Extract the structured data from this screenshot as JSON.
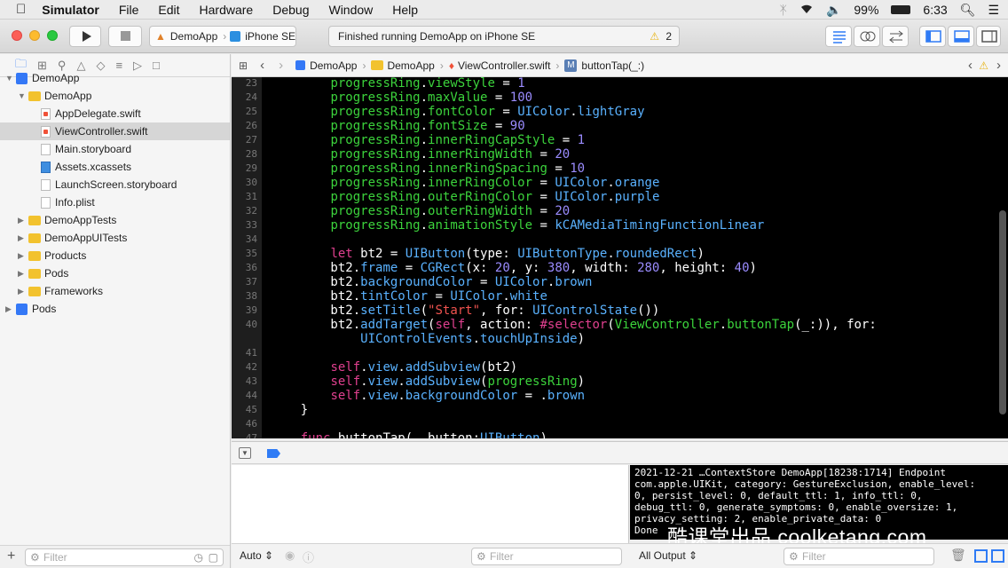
{
  "menubar": {
    "apple": "",
    "app": "Simulator",
    "items": [
      "File",
      "Edit",
      "Hardware",
      "Debug",
      "Window",
      "Help"
    ],
    "battery": "99%",
    "time": "6:33"
  },
  "toolbar": {
    "scheme": "DemoApp",
    "device": "iPhone SE",
    "activity": "Finished running DemoApp on iPhone SE",
    "warnings": "2"
  },
  "navigator": {
    "items": [
      {
        "label": "DemoApp",
        "kind": "project",
        "depth": 0,
        "open": true
      },
      {
        "label": "DemoApp",
        "kind": "folder",
        "depth": 1,
        "open": true
      },
      {
        "label": "AppDelegate.swift",
        "kind": "swift",
        "depth": 2
      },
      {
        "label": "ViewController.swift",
        "kind": "swift",
        "depth": 2,
        "selected": true
      },
      {
        "label": "Main.storyboard",
        "kind": "file",
        "depth": 2
      },
      {
        "label": "Assets.xcassets",
        "kind": "assets",
        "depth": 2
      },
      {
        "label": "LaunchScreen.storyboard",
        "kind": "file",
        "depth": 2
      },
      {
        "label": "Info.plist",
        "kind": "file",
        "depth": 2
      },
      {
        "label": "DemoAppTests",
        "kind": "folder",
        "depth": 1
      },
      {
        "label": "DemoAppUITests",
        "kind": "folder",
        "depth": 1
      },
      {
        "label": "Products",
        "kind": "folder",
        "depth": 1
      },
      {
        "label": "Pods",
        "kind": "folder",
        "depth": 1
      },
      {
        "label": "Frameworks",
        "kind": "folder",
        "depth": 1
      },
      {
        "label": "Pods",
        "kind": "project",
        "depth": 0
      }
    ],
    "filter_placeholder": "Filter"
  },
  "jumpbar": {
    "crumbs": [
      "DemoApp",
      "DemoApp",
      "ViewController.swift",
      "buttonTap(_:)"
    ],
    "method_badge": "M"
  },
  "editor": {
    "line_numbers": [
      "23",
      "24",
      "25",
      "26",
      "27",
      "28",
      "29",
      "30",
      "31",
      "32",
      "33",
      "34",
      "35",
      "36",
      "37",
      "38",
      "39",
      "40",
      "",
      "41",
      "42",
      "43",
      "44",
      "45",
      "46",
      "47"
    ]
  },
  "debug": {
    "auto_label": "Auto",
    "filter_placeholder": "Filter",
    "output_label": "All Output",
    "console_text": "2021-12-21 …ContextStore DemoApp[18238:1714] Endpoint\ncom.apple.UIKit, category: GestureExclusion, enable_level:\n0, persist_level: 0, default_ttl: 1, info_ttl: 0,\ndebug_ttl: 0, generate_symptoms: 0, enable_oversize: 1,\nprivacy_setting: 2, enable_private_data: 0\nDone"
  },
  "watermark": "酷课堂出品 coolketang.com",
  "colors": {
    "editor_bg": "#000000",
    "property": "#3cd33c",
    "type": "#5ab2ff",
    "keyword": "#e0408f",
    "number": "#9b8cff",
    "string": "#f0534f",
    "accent": "#2f7bf5"
  }
}
